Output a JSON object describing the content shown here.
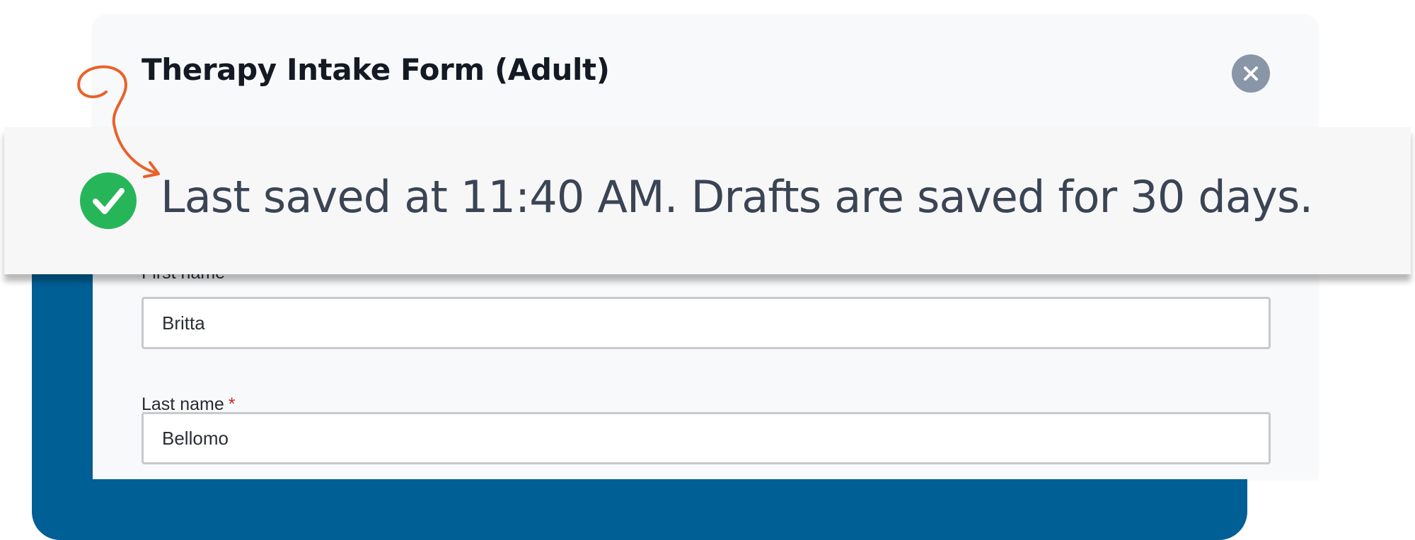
{
  "modal": {
    "title": "Therapy Intake Form (Adult)",
    "close_icon": "close-icon"
  },
  "banner": {
    "message": "Last saved at 11:40 AM. Drafts are saved for 30 days.",
    "icon": "check-circle-icon"
  },
  "form": {
    "first_name": {
      "label": "First name",
      "value": "Britta"
    },
    "last_name": {
      "label": "Last name",
      "required_marker": "*",
      "value": "Bellomo"
    }
  },
  "colors": {
    "brand": "#005f94",
    "success": "#27b55a",
    "annotation": "#e8622a",
    "close_button": "#8996a8",
    "required": "#c92828"
  }
}
